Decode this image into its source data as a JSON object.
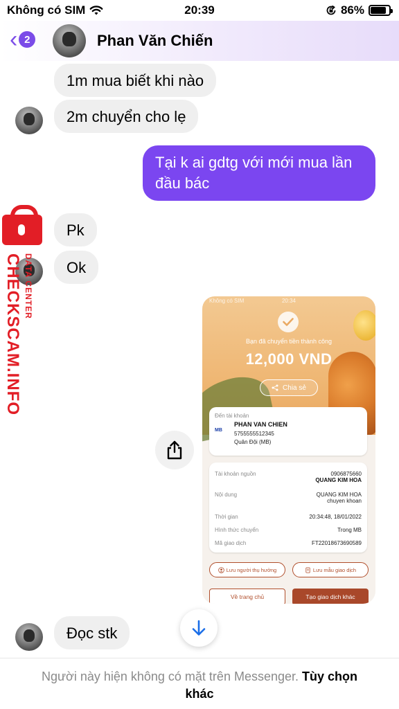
{
  "status_bar": {
    "carrier": "Không có SIM",
    "time": "20:39",
    "battery": "86%",
    "battery_level": 0.86
  },
  "header": {
    "back_badge_count": "2",
    "contact_name": "Phan Văn Chiến"
  },
  "messages": [
    {
      "side": "in",
      "text": "1m mua biết khi nào"
    },
    {
      "side": "in",
      "text": "2m chuyển cho lẹ"
    },
    {
      "side": "out",
      "text": "Tại k ai gdtg với mới mua lần đầu bác"
    },
    {
      "side": "in",
      "text": "Pk"
    },
    {
      "side": "in",
      "text": "Ok"
    },
    {
      "side": "in",
      "text": "Đọc stk"
    }
  ],
  "watermark": {
    "brand": "CHECKSCAM.INFO",
    "sub": "DATA CENTER"
  },
  "receipt": {
    "status_carrier": "Không có SIM",
    "status_time": "20:34",
    "success_text": "Bạn đã chuyển tiền thành công",
    "amount": "12,000 VND",
    "share_label": "Chia sẻ",
    "dest_label": "Đến tài khoản",
    "dest_name": "PHAN VAN CHIEN",
    "dest_account": "5755555512345",
    "dest_bank": "Quân Đội (MB)",
    "bank_logo": "MB",
    "rows": [
      {
        "label": "Tài khoản nguồn",
        "value": "0906875660",
        "value2": "QUANG KIM HOA"
      },
      {
        "label": "Nội dung",
        "value": "QUANG KIM HOA",
        "value2": "chuyen khoan"
      },
      {
        "label": "Thời gian",
        "value": "20:34:48, 18/01/2022",
        "value2": ""
      },
      {
        "label": "Hình thức chuyển",
        "value": "Trong MB",
        "value2": ""
      },
      {
        "label": "Mã giao dịch",
        "value": "FT22018673690589",
        "value2": ""
      }
    ],
    "btn_save_recipient": "Lưu người thụ hưởng",
    "btn_save_template": "Lưu mẫu giao dịch",
    "btn_home": "Về trang chủ",
    "btn_new": "Tạo giao dịch khác"
  },
  "footer": {
    "text": "Người này hiện không có mặt trên Messenger.",
    "action": "Tùy chọn khác"
  },
  "colors": {
    "accent": "#7b46f0",
    "incoming_bubble": "#efefef",
    "watermark": "#e21e26",
    "scroll_arrow": "#1a6ee8"
  }
}
